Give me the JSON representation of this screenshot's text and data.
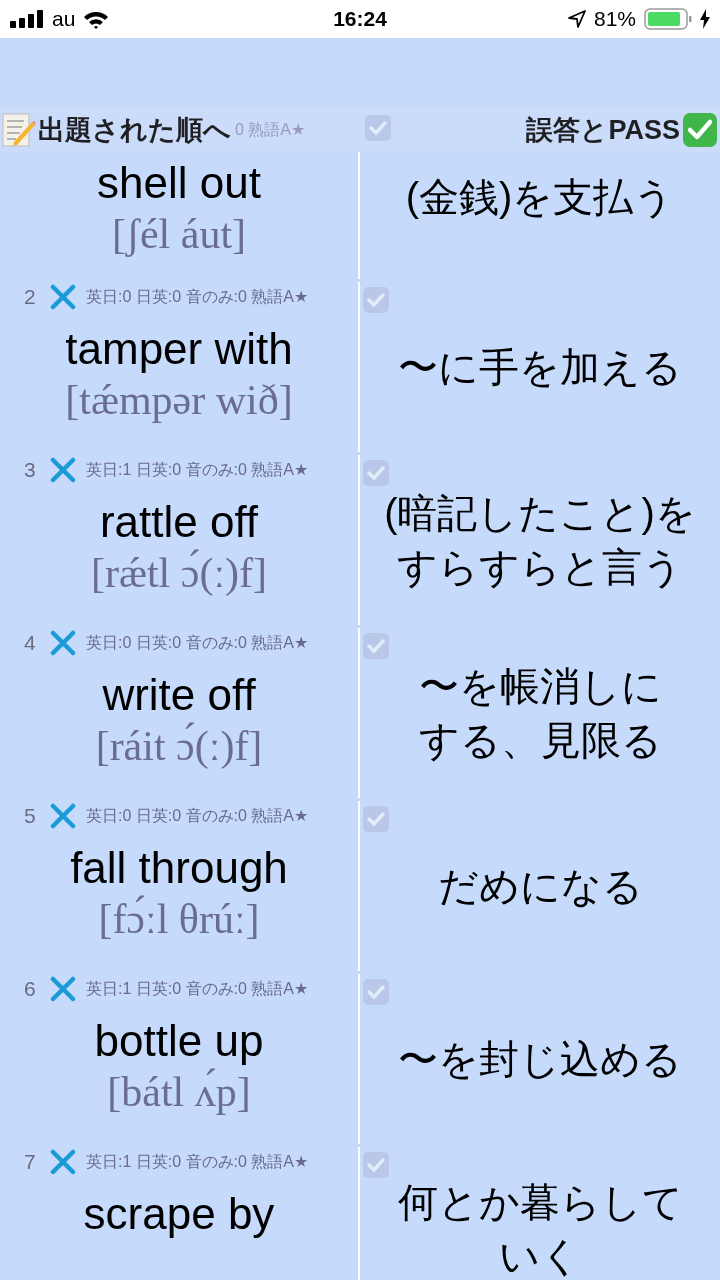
{
  "status_bar": {
    "carrier": "au",
    "time": "16:24",
    "battery": "81%"
  },
  "header": {
    "left_button": "出題された順へ",
    "right_button": "誤答とPASS",
    "behind_meta": "0 熟語A★",
    "behind_checked": true
  },
  "rows": [
    {
      "word": "shell out",
      "pronunciation": "[ʃél áut]",
      "meaning_lines": [
        "(金銭)を支払う"
      ]
    },
    {
      "number": "2",
      "wrong": true,
      "meta": "英日:0 日英:0 音のみ:0 熟語A★",
      "checked": true,
      "word": "tamper with",
      "pronunciation": "[tǽmpər wið]",
      "meaning_lines": [
        "〜に手を加える"
      ]
    },
    {
      "number": "3",
      "wrong": true,
      "meta": "英日:1 日英:0 音のみ:0 熟語A★",
      "checked": true,
      "word": "rattle off",
      "pronunciation": "[rǽtl ɔ́(ː)f]",
      "meaning_lines": [
        "(暗記したこと)を",
        "すらすらと言う"
      ]
    },
    {
      "number": "4",
      "wrong": true,
      "meta": "英日:0 日英:0 音のみ:0 熟語A★",
      "checked": true,
      "word": "write off",
      "pronunciation": "[ráit ɔ́(ː)f]",
      "meaning_lines": [
        "〜を帳消しに",
        "する、見限る"
      ]
    },
    {
      "number": "5",
      "wrong": true,
      "meta": "英日:0 日英:0 音のみ:0 熟語A★",
      "checked": true,
      "word": "fall through",
      "pronunciation": "[fɔ́ːl θrúː]",
      "meaning_lines": [
        "だめになる"
      ]
    },
    {
      "number": "6",
      "wrong": true,
      "meta": "英日:1 日英:0 音のみ:0 熟語A★",
      "checked": true,
      "word": "bottle up",
      "pronunciation": "[bátl ʌ́p]",
      "meaning_lines": [
        "〜を封じ込める"
      ]
    },
    {
      "number": "7",
      "wrong": true,
      "meta": "英日:1 日英:0 音のみ:0 熟語A★",
      "checked": true,
      "word": "scrape by",
      "meaning_lines": [
        "何とか暮らして",
        "いく"
      ]
    }
  ]
}
